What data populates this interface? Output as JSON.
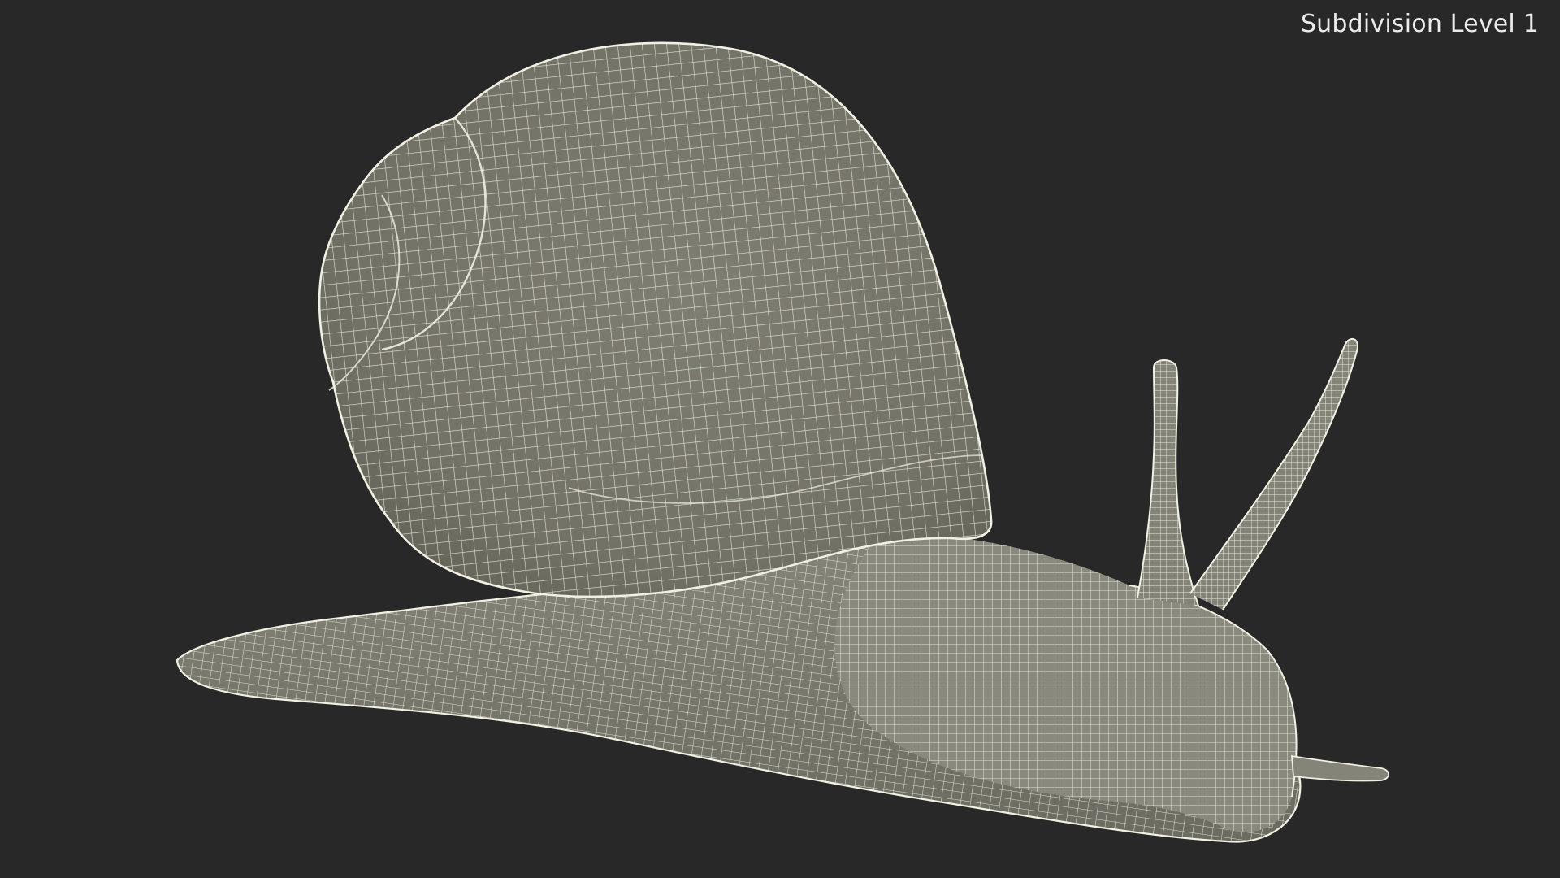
{
  "viewport": {
    "overlay_label": "Subdivision Level 1",
    "background_color": "#282828",
    "mesh_fill_color": "#7c7b6f",
    "wire_color": "#f2f0e2"
  },
  "model": {
    "icon": "snail-wireframe-model"
  }
}
